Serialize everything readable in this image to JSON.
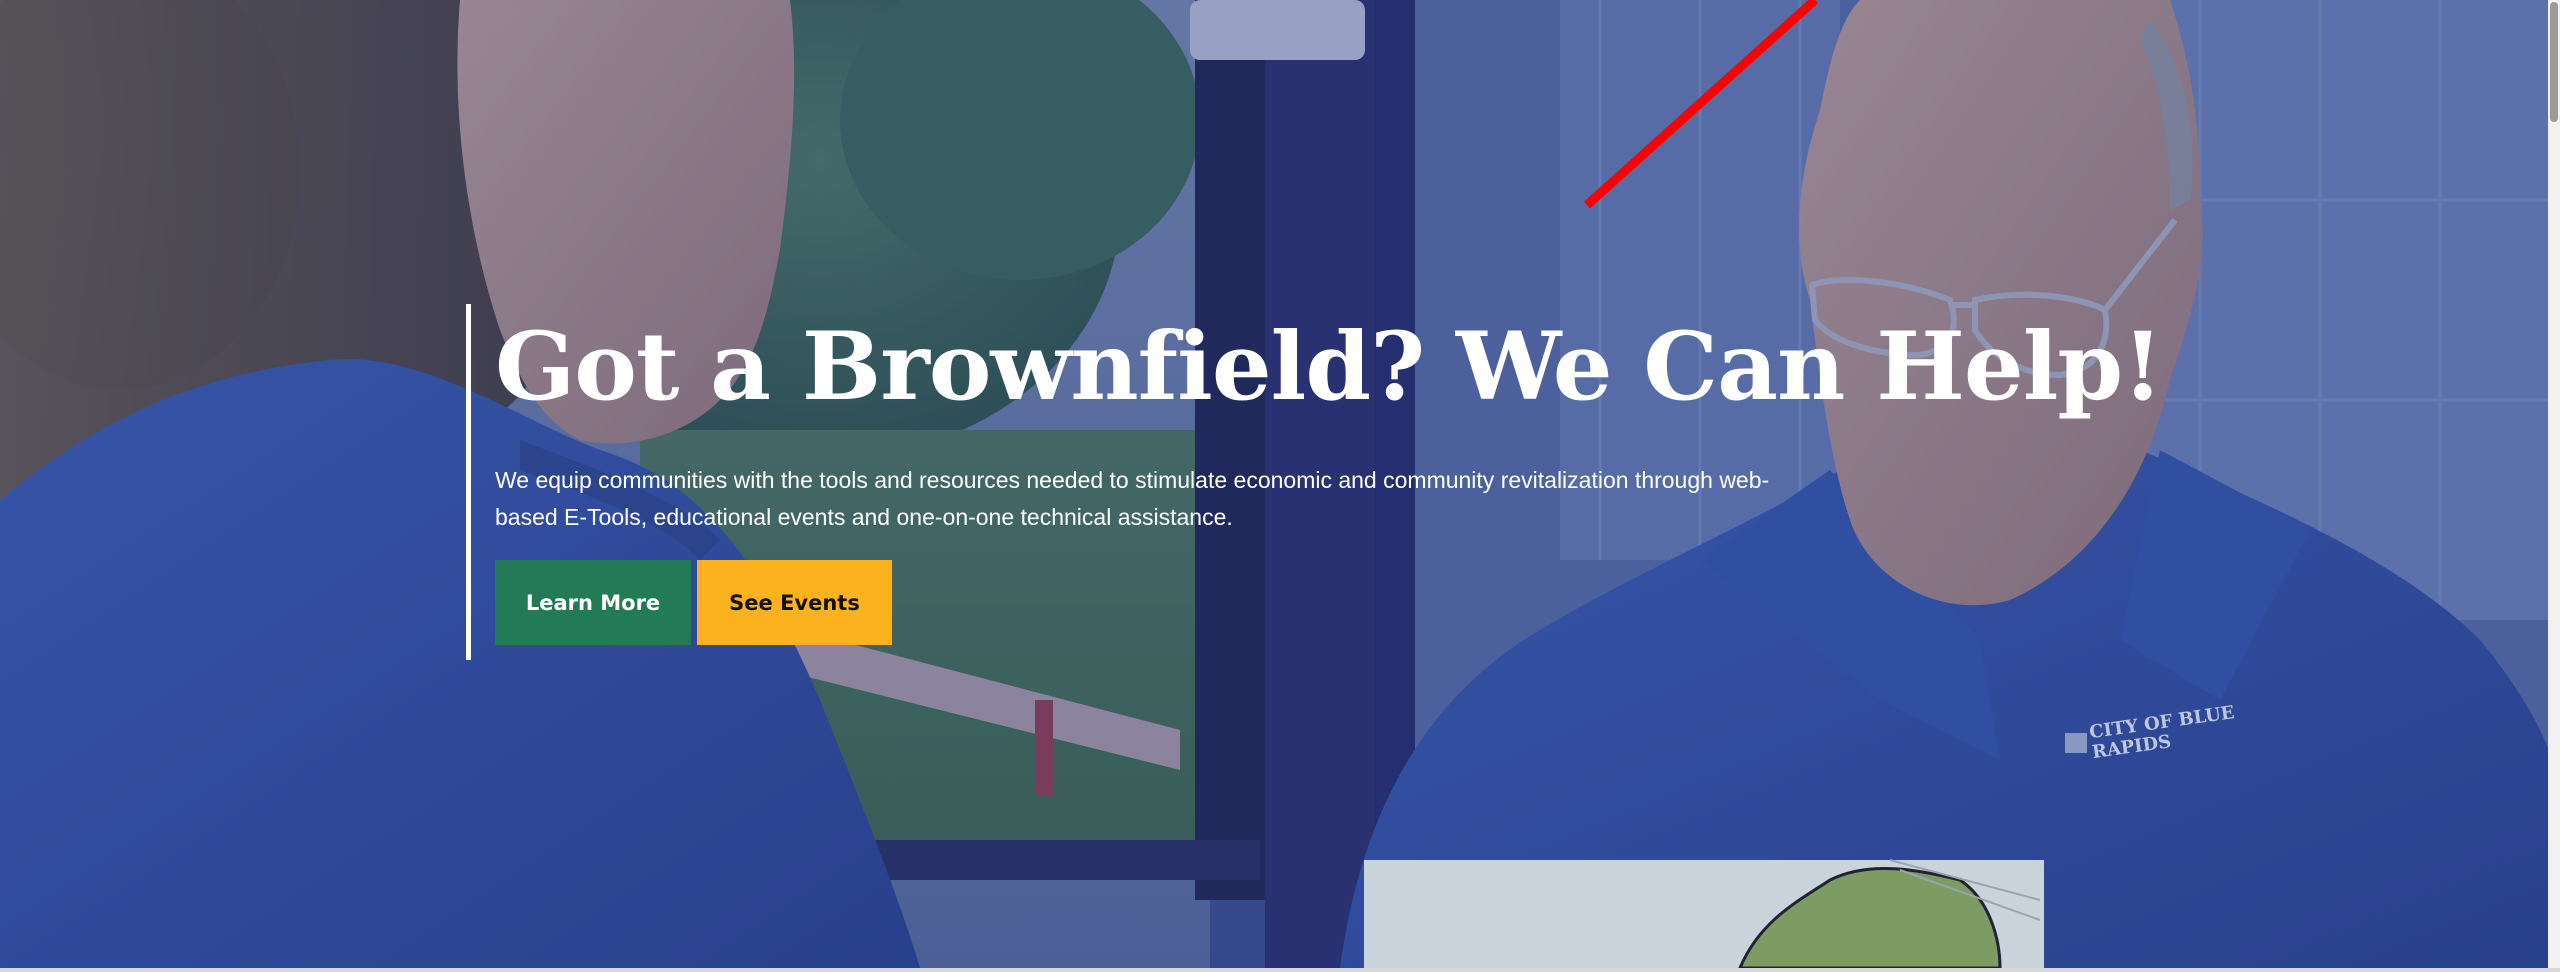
{
  "hero": {
    "headline": "Got a Brownfield? We Can Help!",
    "description": "We equip communities with the tools and resources needed to stimulate economic and community revitalization through web-based E-Tools, educational events and one-on-one technical assistance.",
    "buttons": {
      "learn_more": "Learn More",
      "see_events": "See Events"
    },
    "shirt_logo_text": "CITY OF BLUE RAPIDS"
  },
  "colors": {
    "learn_more": "#227b55",
    "see_events": "#fbb21e",
    "overlay": "#2b3f86"
  }
}
